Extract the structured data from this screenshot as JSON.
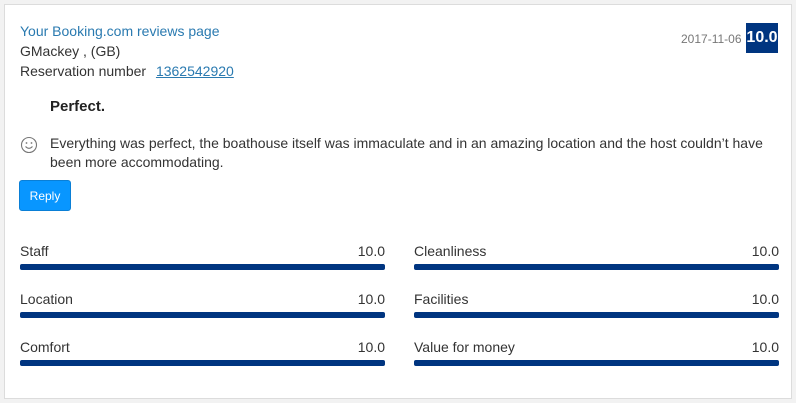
{
  "header": {
    "reviews_link": "Your Booking.com reviews page",
    "guest": "GMackey , (GB)",
    "reservation_label": "Reservation number",
    "reservation_number": "1362542920",
    "date": "2017-11-06",
    "score": "10.0"
  },
  "review": {
    "title": "Perfect.",
    "positive_icon": "smiley-icon",
    "text": "Everything was perfect, the boathouse itself was immaculate and in an amazing location and the host couldn’t have been more accommodating."
  },
  "actions": {
    "reply_label": "Reply"
  },
  "categories": [
    {
      "label": "Staff",
      "value": "10.0",
      "fraction": 1.0
    },
    {
      "label": "Cleanliness",
      "value": "10.0",
      "fraction": 1.0
    },
    {
      "label": "Location",
      "value": "10.0",
      "fraction": 1.0
    },
    {
      "label": "Facilities",
      "value": "10.0",
      "fraction": 1.0
    },
    {
      "label": "Comfort",
      "value": "10.0",
      "fraction": 1.0
    },
    {
      "label": "Value for money",
      "value": "10.0",
      "fraction": 1.0
    }
  ],
  "colors": {
    "accent_navy": "#003580",
    "link_blue": "#2a7ab0",
    "button_blue": "#0896ff"
  }
}
